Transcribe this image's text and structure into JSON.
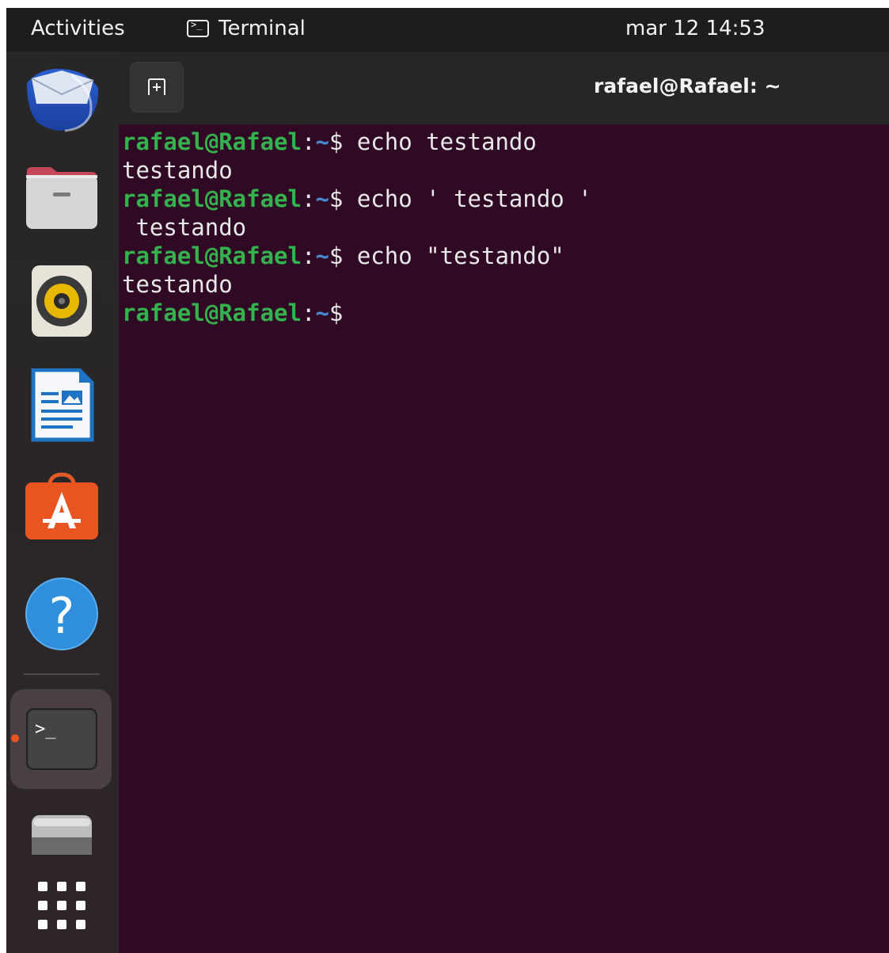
{
  "topbar": {
    "activities": "Activities",
    "app_name": "Terminal",
    "clock": "mar 12  14:53"
  },
  "dock": {
    "items": [
      {
        "name": "Thunderbird Mail",
        "icon": "thunderbird-icon"
      },
      {
        "name": "Files",
        "icon": "files-folder-icon"
      },
      {
        "name": "Rhythmbox",
        "icon": "rhythmbox-speaker-icon"
      },
      {
        "name": "LibreOffice Writer",
        "icon": "writer-document-icon"
      },
      {
        "name": "Ubuntu Software",
        "icon": "software-store-icon"
      },
      {
        "name": "Help",
        "icon": "help-icon"
      },
      {
        "name": "Terminal",
        "icon": "terminal-icon",
        "running": true
      },
      {
        "name": "Drive",
        "icon": "drive-icon"
      },
      {
        "name": "Show Applications",
        "icon": "app-grid-icon"
      }
    ]
  },
  "window": {
    "title": "rafael@Rafael: ~",
    "new_tab_icon": "new-tab-icon"
  },
  "terminal": {
    "user_host": "rafael@Rafael",
    "colon": ":",
    "path": "~",
    "dollar": "$",
    "lines": [
      {
        "type": "prompt",
        "command": " echo testando"
      },
      {
        "type": "output",
        "text": "testando"
      },
      {
        "type": "prompt",
        "command": " echo ' testando '"
      },
      {
        "type": "output",
        "text": " testando"
      },
      {
        "type": "prompt",
        "command": " echo \"testando\""
      },
      {
        "type": "output",
        "text": "testando"
      },
      {
        "type": "prompt",
        "command": ""
      }
    ]
  },
  "colors": {
    "terminal_bg": "#300a24",
    "prompt_user": "#33b24e",
    "prompt_path": "#4a8bd6",
    "accent": "#e95420"
  }
}
